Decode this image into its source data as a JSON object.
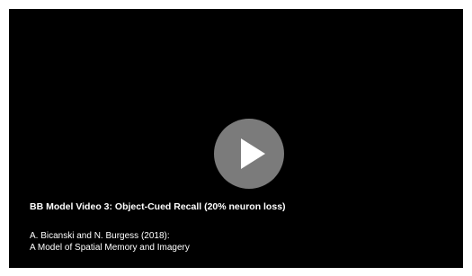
{
  "video": {
    "title": "BB Model Video 3: Object-Cued Recall (20% neuron loss)",
    "citation_line1": "A. Bicanski and N. Burgess (2018):",
    "citation_line2": "A Model of Spatial Memory and Imagery",
    "play_icon": "play-icon",
    "background_color": "#000000",
    "play_button_color": "#8c8c8c"
  }
}
